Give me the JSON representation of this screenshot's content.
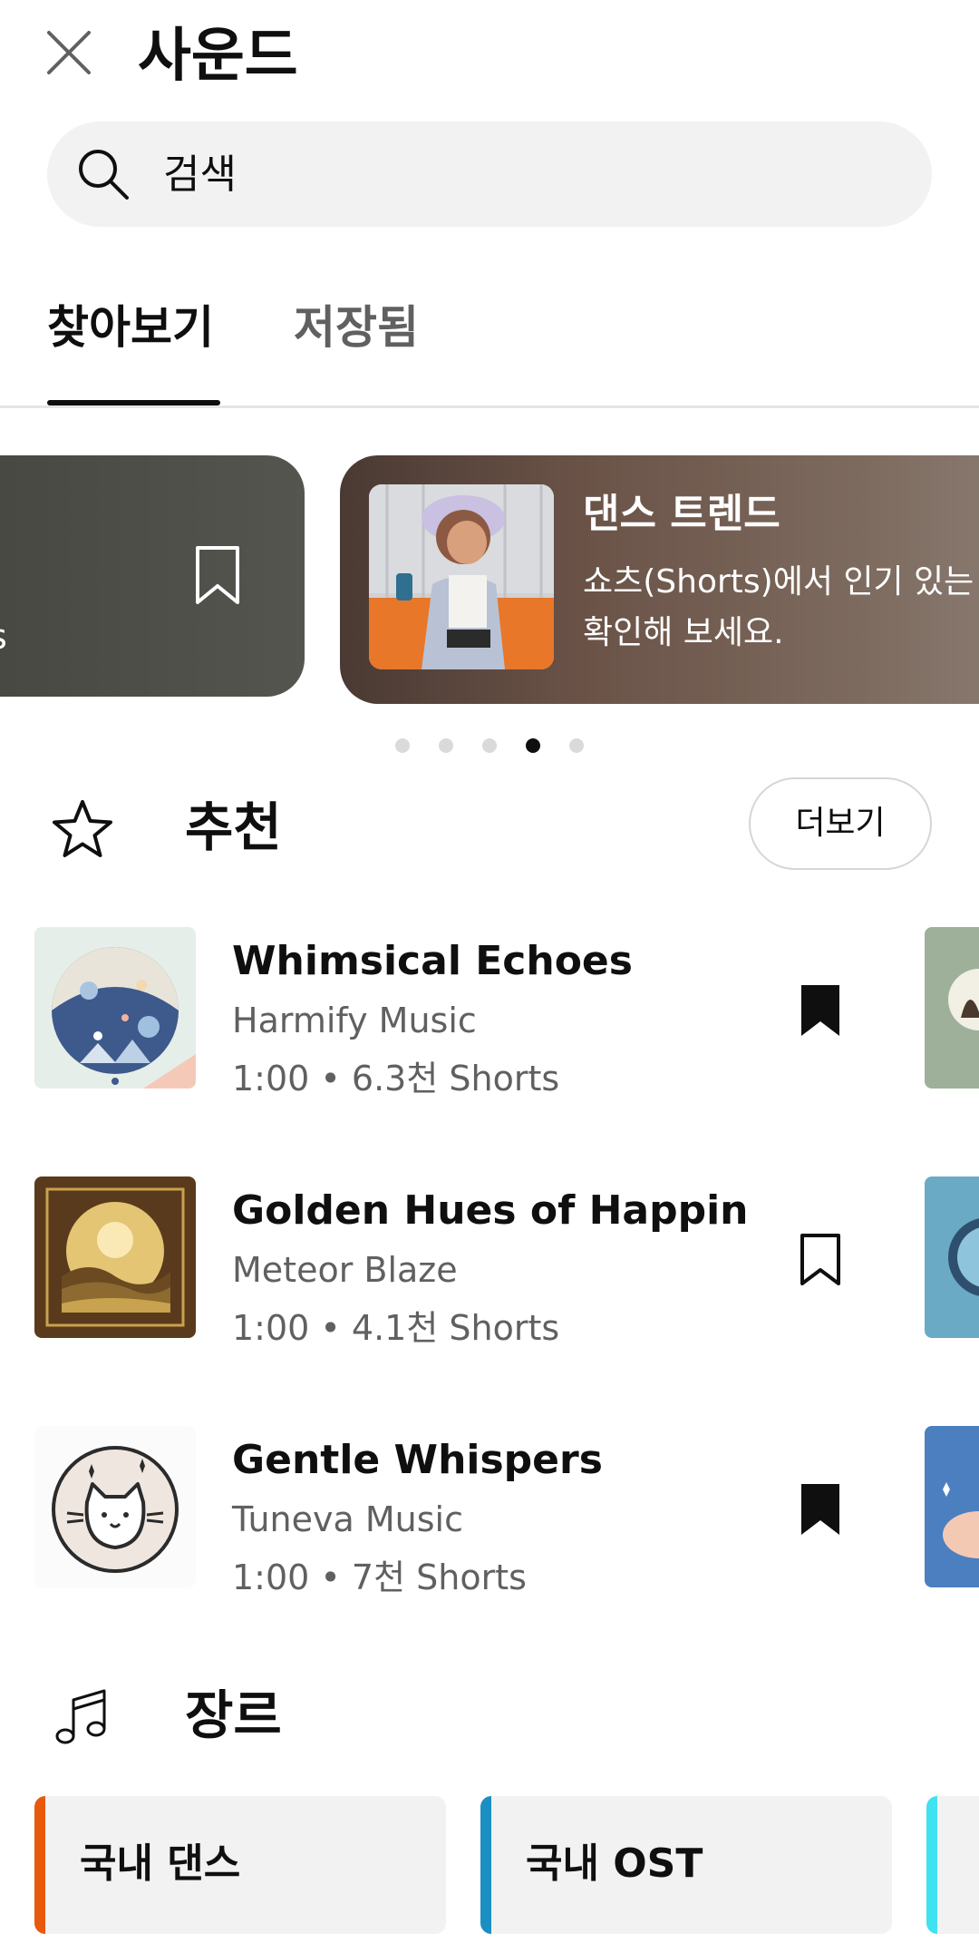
{
  "header": {
    "title": "사운드",
    "close_icon": "close-icon"
  },
  "search": {
    "placeholder": "검색",
    "icon": "search-icon"
  },
  "tabs": [
    {
      "label": "찾아보기",
      "selected": true
    },
    {
      "label": "저장됨",
      "selected": false
    }
  ],
  "carousel": {
    "prev_card_text": "s",
    "main_card": {
      "title": "댄스 트렌드",
      "description": "쇼츠(Shorts)에서 인기 있는 음악을 확인해 보세요."
    },
    "page_count": 5,
    "active_page": 4
  },
  "recommended": {
    "title": "추천",
    "icon": "star-outline-icon",
    "more_label": "더보기",
    "tracks": [
      {
        "title": "Whimsical Echoes",
        "artist": "Harmify Music",
        "meta": "1:00 • 6.3천 Shorts",
        "saved": true
      },
      {
        "title": "Golden Hues of Happine…",
        "artist": "Meteor Blaze",
        "meta": "1:00 • 4.1천 Shorts",
        "saved": false
      },
      {
        "title": "Gentle Whispers",
        "artist": "Tuneva Music",
        "meta": "1:00 • 7천 Shorts",
        "saved": true
      }
    ]
  },
  "genres": {
    "title": "장르",
    "icon": "music-note-icon",
    "items": [
      {
        "label": "국내 댄스",
        "color": "#e8590c"
      },
      {
        "label": "국내 OST",
        "color": "#1b8fc4"
      },
      {
        "label": "",
        "color": "#3fe2f0"
      }
    ]
  },
  "colors": {
    "text": "#0f0f0f",
    "secondary_text": "#606060",
    "chip_bg": "#f2f2f2"
  }
}
